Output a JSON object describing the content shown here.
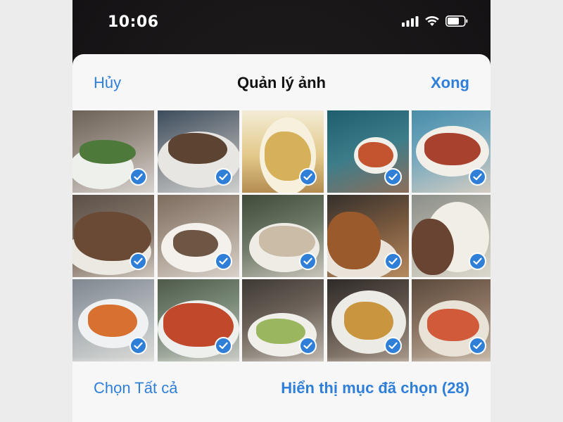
{
  "status_bar": {
    "time": "10:06",
    "icons": [
      "cellular-signal-icon",
      "wifi-icon",
      "battery-icon"
    ]
  },
  "nav": {
    "cancel_label": "Hủy",
    "title": "Quản lý ảnh",
    "done_label": "Xong"
  },
  "photos": [
    {
      "subject": "herb-salad-plate",
      "selected": true
    },
    {
      "subject": "grilled-meat-plate",
      "selected": true
    },
    {
      "subject": "beer-glasses",
      "selected": true
    },
    {
      "subject": "soup-bowls-table",
      "selected": true
    },
    {
      "subject": "spicy-salad-plate",
      "selected": true
    },
    {
      "subject": "roasted-chicken-pieces",
      "selected": true
    },
    {
      "subject": "sliced-beef-plate",
      "selected": true
    },
    {
      "subject": "sliced-meat-herbs",
      "selected": true
    },
    {
      "subject": "roast-duck",
      "selected": true
    },
    {
      "subject": "hand-over-dishes",
      "selected": true
    },
    {
      "subject": "crab-platter",
      "selected": true
    },
    {
      "subject": "lobster-platter",
      "selected": true
    },
    {
      "subject": "noodle-bowl",
      "selected": true
    },
    {
      "subject": "fried-balls-bowl",
      "selected": true
    },
    {
      "subject": "fruit-platter-table",
      "selected": true
    }
  ],
  "toolbar": {
    "select_all_label": "Chọn Tất cả",
    "show_selected_label": "Hiển thị mục đã chọn (28)"
  },
  "colors": {
    "accent": "#2f7fd9",
    "sheet_background": "#f7f7f7",
    "title_text": "#111111"
  }
}
